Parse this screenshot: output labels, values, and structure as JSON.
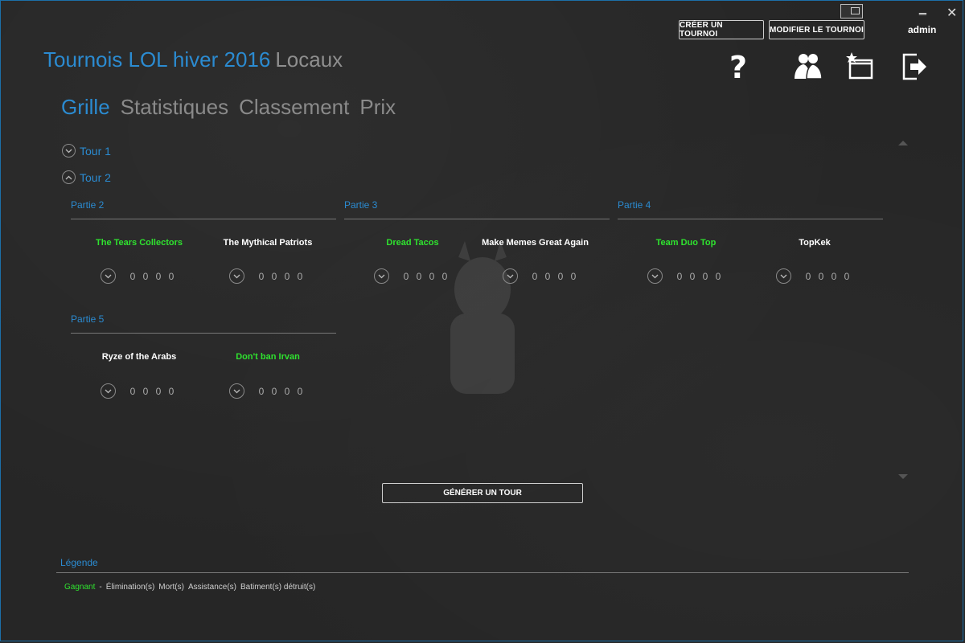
{
  "window": {
    "minimize": "‗",
    "close": "✕"
  },
  "header": {
    "create_btn": "CRÉER UN TOURNOI",
    "modify_btn": "MODIFIER LE TOURNOI",
    "user": "admin",
    "title": "Tournois LOL hiver 2016",
    "subtitle": "Locaux",
    "icons": [
      "help-icon",
      "teams-icon",
      "featured-window-icon",
      "logout-icon"
    ]
  },
  "tabs": [
    "Grille",
    "Statistiques",
    "Classement",
    "Prix"
  ],
  "active_tab": "Grille",
  "tours": [
    "Tour 1",
    "Tour 2"
  ],
  "matches": [
    {
      "label": "Partie 2",
      "team1": {
        "name": "The Tears Collectors",
        "winner": true,
        "stats": [
          "0",
          "0",
          "0",
          "0"
        ]
      },
      "team2": {
        "name": "The Mythical Patriots",
        "winner": false,
        "stats": [
          "0",
          "0",
          "0",
          "0"
        ]
      }
    },
    {
      "label": "Partie 3",
      "team1": {
        "name": "Dread Tacos",
        "winner": true,
        "stats": [
          "0",
          "0",
          "0",
          "0"
        ]
      },
      "team2": {
        "name": "Make Memes Great Again",
        "winner": false,
        "stats": [
          "0",
          "0",
          "0",
          "0"
        ]
      }
    },
    {
      "label": "Partie 4",
      "team1": {
        "name": "Team Duo Top",
        "winner": true,
        "stats": [
          "0",
          "0",
          "0",
          "0"
        ]
      },
      "team2": {
        "name": "TopKek",
        "winner": false,
        "stats": [
          "0",
          "0",
          "0",
          "0"
        ]
      }
    },
    {
      "label": "Partie 5",
      "team1": {
        "name": "Ryze of the Arabs",
        "winner": false,
        "stats": [
          "0",
          "0",
          "0",
          "0"
        ]
      },
      "team2": {
        "name": "Don't ban Irvan",
        "winner": true,
        "stats": [
          "0",
          "0",
          "0",
          "0"
        ]
      }
    }
  ],
  "generate_btn": "GÉNÉRER UN TOUR",
  "legend": {
    "title": "Légende",
    "winner": "Gagnant",
    "sep": "-",
    "items": [
      "Élimination(s)",
      "Mort(s)",
      "Assistance(s)",
      "Batiment(s) détruit(s)"
    ]
  },
  "colors": {
    "accent": "#2b8bd1",
    "winner": "#2fe22f",
    "bg": "#262626"
  }
}
